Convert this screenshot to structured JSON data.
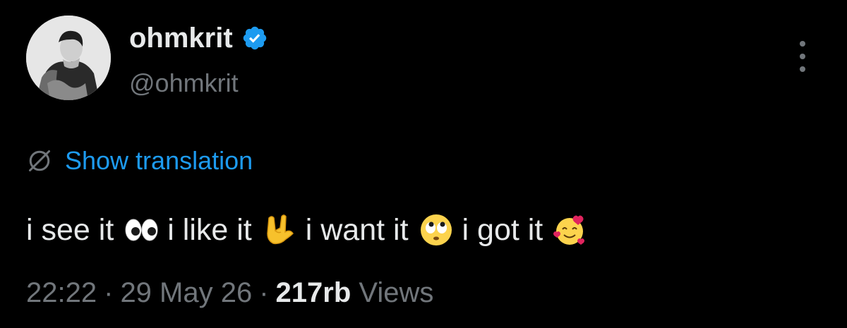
{
  "author": {
    "display_name": "ohmkrit",
    "handle": "@ohmkrit",
    "verified": true,
    "verified_color": "#1d9bf0"
  },
  "translation": {
    "label": "Show translation",
    "icon": "globe-slash-icon",
    "color": "#1d9bf0"
  },
  "tweet": {
    "segments": [
      {
        "text": "i see it",
        "emoji": "eyes-emoji"
      },
      {
        "text": "i like it",
        "emoji": "rock-on-hand-emoji"
      },
      {
        "text": "i want it",
        "emoji": "rolling-eyes-emoji"
      },
      {
        "text": "i got it",
        "emoji": "smiling-face-with-hearts-emoji"
      }
    ],
    "seg1": "i see it",
    "seg2": "i like it",
    "seg3": "i want it",
    "seg4": "i got it"
  },
  "meta": {
    "time": "22:22",
    "separator": "·",
    "date": "29 May 26",
    "views_count": "217rb",
    "views_label": "Views"
  },
  "colors": {
    "background": "#000000",
    "primary_text": "#e7e9ea",
    "secondary_text": "#71767b",
    "accent": "#1d9bf0"
  },
  "more_menu_icon": "more-vertical-icon"
}
